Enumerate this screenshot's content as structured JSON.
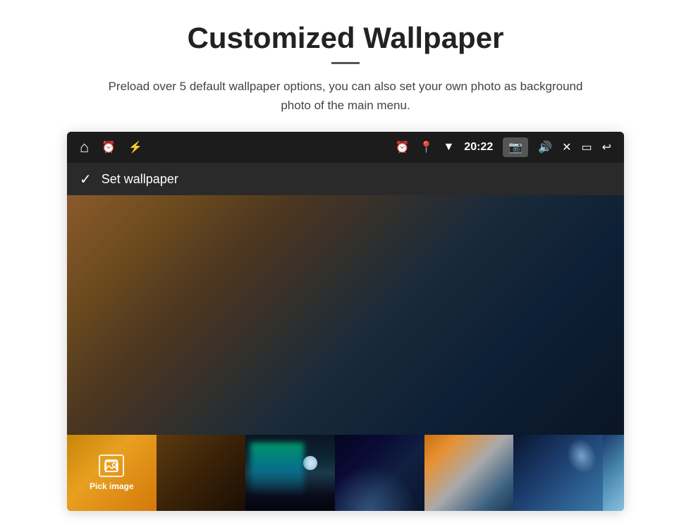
{
  "page": {
    "title": "Customized Wallpaper",
    "subtitle_line1": "Preload over 5 default wallpaper options, you can also set your own photo as background",
    "subtitle_line2": "photo of the main menu."
  },
  "statusbar": {
    "time": "20:22"
  },
  "appbar": {
    "title": "Set wallpaper"
  },
  "thumbnails": {
    "pick_label": "Pick image"
  }
}
